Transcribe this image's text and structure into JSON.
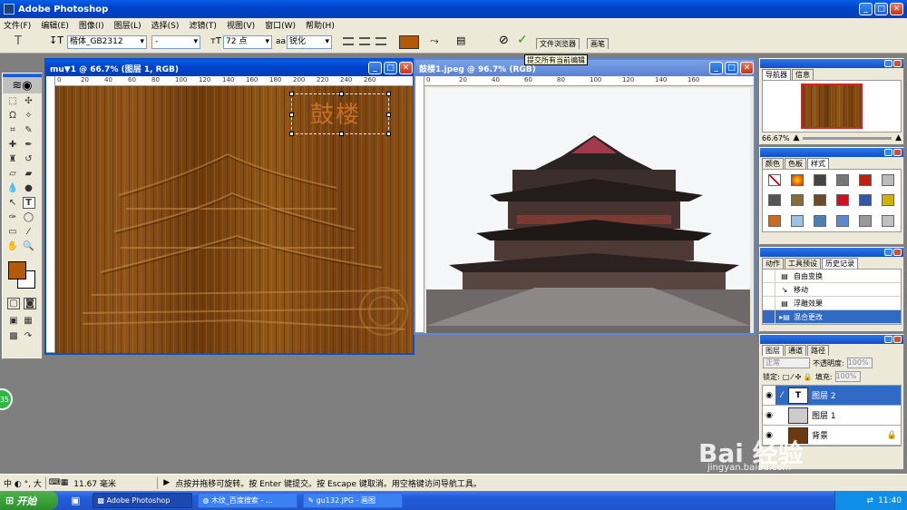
{
  "app": {
    "title": "Adobe Photoshop"
  },
  "menu": [
    "文件(F)",
    "编辑(E)",
    "图像(I)",
    "图层(L)",
    "选择(S)",
    "滤镜(T)",
    "视图(V)",
    "窗口(W)",
    "帮助(H)"
  ],
  "options": {
    "font_family": "楷体_GB2312",
    "font_style": "-",
    "font_size": "72 点",
    "aa_label": "aa",
    "antialias": "锐化",
    "color": "#b25a0a",
    "tooltip": "提交所有当前编辑",
    "tab_file_browser": "文件浏览器",
    "tab_brushes": "画笔"
  },
  "doc1": {
    "title": "mu▼1 @ 66.7% (图层 1, RGB)",
    "ruler_labels": [
      "0",
      "20",
      "40",
      "60",
      "80",
      "100",
      "120",
      "140",
      "160",
      "180",
      "200",
      "220",
      "240",
      "260"
    ],
    "text_layer": "鼓楼"
  },
  "doc2": {
    "title": "鼓楼1.jpeg @ 96.7% (RGB)",
    "ruler_labels": [
      "0",
      "20",
      "40",
      "60",
      "80",
      "100",
      "120",
      "140",
      "160"
    ]
  },
  "navigator": {
    "tabs": [
      "导航器",
      "信息"
    ],
    "zoom": "66.67%"
  },
  "swatches": {
    "tabs": [
      "颜色",
      "色板",
      "样式"
    ]
  },
  "history": {
    "tabs": [
      "动作",
      "工具预设",
      "历史记录"
    ],
    "items": [
      "自由变换",
      "移动",
      "浮雕效果",
      "混合更改"
    ]
  },
  "layers": {
    "tabs": [
      "图层",
      "通道",
      "路径"
    ],
    "blend": "正常",
    "opacity_label": "不透明度:",
    "opacity": "100%",
    "lock_label": "锁定:",
    "fill_label": "填充:",
    "fill": "100%",
    "items": [
      "图层 2",
      "图层 1",
      "背景"
    ]
  },
  "status": {
    "ime": "中 ◐ °, 大",
    "size": "11.67 毫米",
    "message": "点按并拖移可旋转。按 Enter 键提交。按 Escape 键取消。用空格键访问导航工具。"
  },
  "taskbar": {
    "start": "开始",
    "tasks": [
      "Adobe Photoshop",
      "木纹_百度搜索 - ...",
      "gu132.JPG - 画图"
    ],
    "clock": "11:40"
  },
  "watermark": {
    "brand": "Bai 经验",
    "url": "jingyan.baidu.com"
  },
  "side_badge": "35",
  "colors": {
    "foreground": "#b25a0a",
    "background": "#ffffff",
    "selected_row": "#316ac5"
  }
}
